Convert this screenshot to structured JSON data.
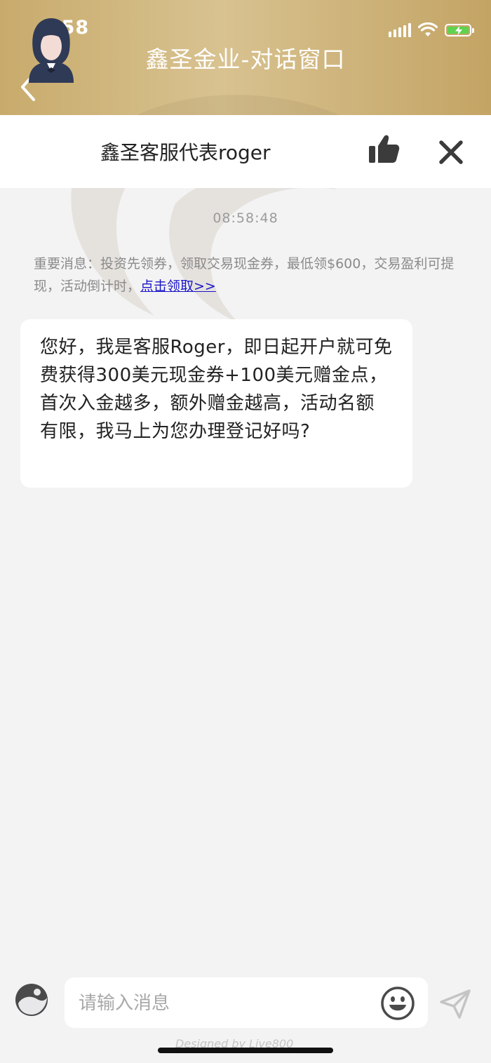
{
  "status_bar": {
    "time": "8:58"
  },
  "header": {
    "title": "鑫圣金业-对话窗口"
  },
  "agent": {
    "name": "鑫圣客服代表roger"
  },
  "chat": {
    "timestamp": "08:58:48",
    "notice_text": "重要消息：投资先领券，领取交易现金券，最低领$600，交易盈利可提现，活动倒计时，",
    "notice_link": "点击领取>>",
    "message": "您好，我是客服Roger，即日起开户就可免费获得300美元现金券+100美元赠金点，首次入金越多，额外赠金越高，活动名额有限，我马上为您办理登记好吗?"
  },
  "input": {
    "placeholder": "请输入消息"
  },
  "footer": {
    "credit": "Designed by Live800"
  },
  "colors": {
    "header_gold": "#c8ab6c",
    "link_blue": "#1a14c9",
    "battery_green": "#5fd24f"
  }
}
